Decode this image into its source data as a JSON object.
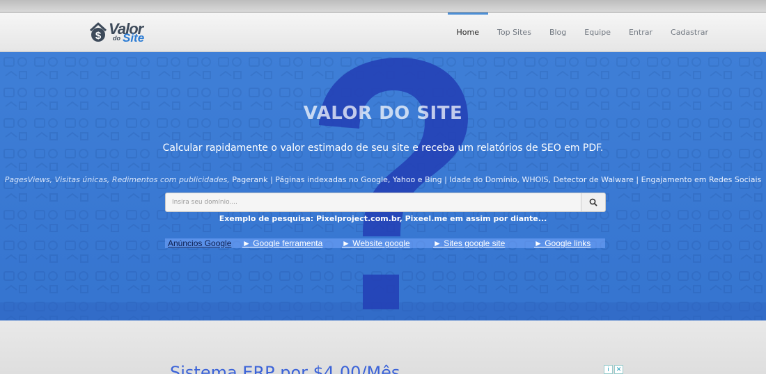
{
  "brand": {
    "valor": "Valor",
    "do": "do",
    "site": "Site"
  },
  "nav": [
    {
      "label": "Home",
      "active": true
    },
    {
      "label": "Top Sites"
    },
    {
      "label": "Blog"
    },
    {
      "label": "Equipe"
    },
    {
      "label": "Entrar"
    },
    {
      "label": "Cadastrar"
    }
  ],
  "hero": {
    "title": "VALOR DO SITE",
    "subtitle": "Calcular rapidamente o valor estimado de seu site e receba um relatórios de SEO em PDF.",
    "features_italic": "PagesViews, Visitas únicas, Redimentos com publicidades,",
    "features_rest": " Pagerank | Páginas indexadas no Google, Yahoo e Bing | Idade do Domínio, WHOIS, Detector de Walware | Engajamento em Redes Sociais",
    "search_placeholder": "Insira seu domínio....",
    "example": "Exemplo de pesquisa: Pixelproject.com.br, Pixeel.me em assim por diante..."
  },
  "ads": {
    "title": "Anúncios Google",
    "links": [
      "► Google ferramenta",
      "► Website google",
      "► Sites google site",
      "► Google links"
    ]
  },
  "banner": {
    "text": "Sistema ERP por $4,00/Mês"
  },
  "colors": {
    "hero": "#3f7fd7",
    "accent": "#4d8fd6",
    "qmark": "#1f3faf"
  },
  "icons": {
    "search": "search-icon",
    "logo": "dollar-house-icon"
  }
}
